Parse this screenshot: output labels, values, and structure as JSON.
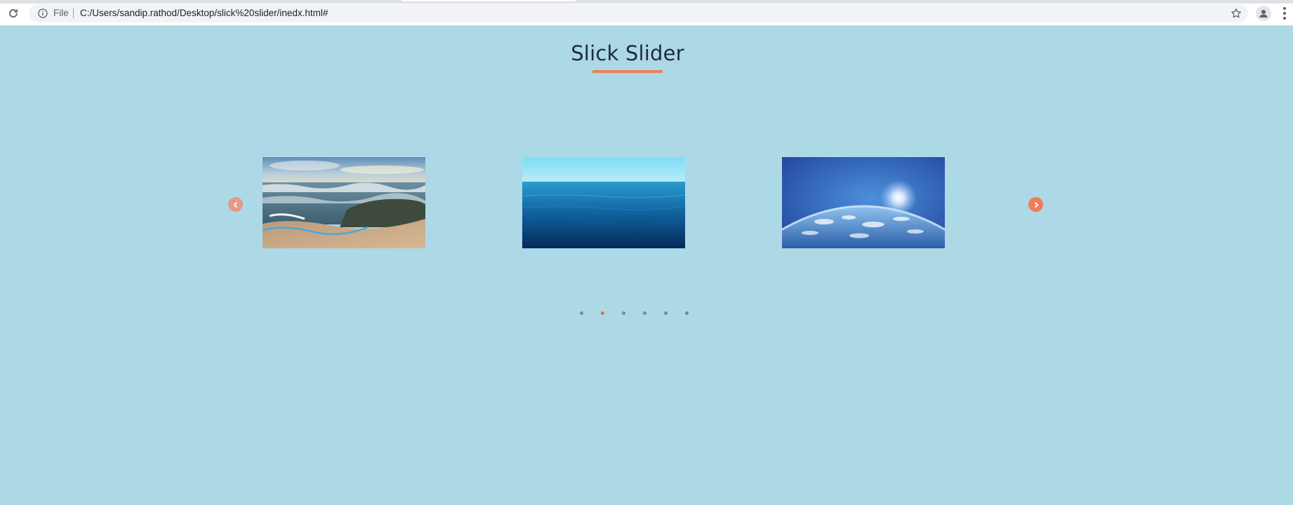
{
  "browser": {
    "scheme_label": "File",
    "url": "C:/Users/sandip.rathod/Desktop/slick%20slider/inedx.html#",
    "icons": [
      "reload-icon",
      "info-icon",
      "star-icon",
      "profile-icon",
      "menu-icon"
    ]
  },
  "page": {
    "title": "Slick Slider",
    "accent_color": "#ef7d58",
    "background_color": "#add8e6"
  },
  "slider": {
    "slides": [
      {
        "name": "beach-waves-image"
      },
      {
        "name": "ocean-horizon-image"
      },
      {
        "name": "earth-atmosphere-image"
      }
    ],
    "prev_icon": "chevron-left-icon",
    "next_icon": "chevron-right-icon",
    "dots": [
      {
        "active": false
      },
      {
        "active": true
      },
      {
        "active": false
      },
      {
        "active": false
      },
      {
        "active": false
      },
      {
        "active": false
      }
    ]
  }
}
